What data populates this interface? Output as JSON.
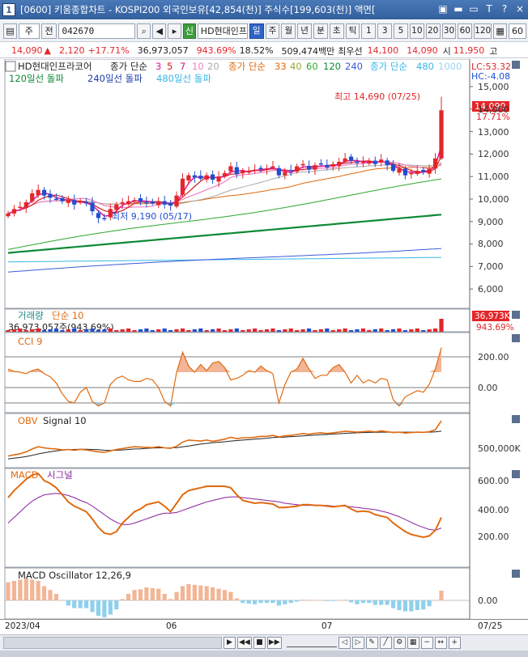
{
  "window": {
    "title": "[0600] 키움종합차트 - KOSPI200 외국인보유[42,854(천)] 주식수[199,603(천)] 액면[",
    "app_icon": "1",
    "buttons": [
      "▣",
      "▬",
      "▭",
      "T",
      "?",
      "×"
    ]
  },
  "toolbar": {
    "period_type": "주",
    "view_label": "전",
    "stock_code": "042670",
    "stock_name": "HD현대인프",
    "credit_badge": "신",
    "timeframes": [
      "일",
      "주",
      "월",
      "년",
      "분",
      "초",
      "틱"
    ],
    "timeframe_selected": "일",
    "minute_presets": [
      "1",
      "3",
      "5",
      "10",
      "20",
      "30",
      "60",
      "120"
    ],
    "count": "60"
  },
  "quote": {
    "price": "14,090",
    "change": "2,120",
    "change_pct": "+17.71%",
    "volume": "36,973,057",
    "volume_ratio": "943.69%",
    "turnover": "18.52%",
    "amount": "509,474백만",
    "best_ask_label": "최우선",
    "best_ask": "14,100",
    "best_bid": "14,090",
    "open_label": "시",
    "open": "11,950",
    "high_label": "고"
  },
  "price_panel": {
    "title": "HD현대인프라코어",
    "ma_label": "종가 단순",
    "ma_periods_1": [
      "3",
      "5",
      "7",
      "10",
      "20"
    ],
    "ma_label_2": "종가 단순",
    "ma_periods_2": [
      "33",
      "40",
      "60",
      "120",
      "240"
    ],
    "ma_label_3": "종가 단순",
    "ma_periods_3": [
      "480",
      "1000"
    ],
    "breakout_labels": [
      "120일선 돌파",
      "240일선 돌파",
      "480일선 돌파"
    ],
    "lc": "LC:53.32",
    "hc": "HC:-4.08",
    "high_note": "최고 14,690 (07/25)",
    "low_note": "최저 9,190 (05/17)",
    "price_tag": "14,090",
    "pct_tag": "17.71%",
    "y_ticks": [
      "15,000",
      "14,000",
      "13,000",
      "12,000",
      "11,000",
      "10,000",
      "9,000",
      "8,000",
      "7,000",
      "6,000"
    ]
  },
  "volume_panel": {
    "title": "거래량",
    "ma_label": "단순 10",
    "value_text": "36,973,057주(943.69%)",
    "tag_value": "36,973K",
    "tag_pct": "943.69%"
  },
  "cci_panel": {
    "title": "CCI 9",
    "y_ticks": [
      "200.00",
      "0.00"
    ]
  },
  "obv_panel": {
    "title": "OBV",
    "signal": "Signal 10",
    "y_ticks": [
      "500,000K"
    ]
  },
  "macd_panel": {
    "title": "MACD",
    "signal": "시그널",
    "y_ticks": [
      "600.00",
      "400.00",
      "200.00"
    ]
  },
  "osc_panel": {
    "title": "MACD Oscillator 12,26,9",
    "y_ticks": [
      "0.00"
    ]
  },
  "dates": {
    "d1": "2023/04",
    "d2": "06",
    "d3": "07",
    "cursor": "07/25"
  },
  "colors": {
    "up": "#e3262a",
    "down": "#1f4fd0",
    "ma_short": "#e0189a",
    "ma_33": "#e06a10",
    "ma_60": "#2fa72f",
    "ma_120": "#0d8a37",
    "ma_240": "#3b5bd8",
    "ma_480": "#36b6e8",
    "osc_up": "#f2b596",
    "osc_down": "#8fd0ec"
  },
  "chart_data": {
    "type": "candlestick",
    "x_start": "2023/04",
    "x_end": "07/25",
    "price_close": [
      9500,
      9700,
      9800,
      10000,
      10400,
      10550,
      10300,
      10200,
      10150,
      10050,
      10100,
      9900,
      10050,
      9950,
      9600,
      9300,
      9250,
      9700,
      9900,
      10000,
      10050,
      10100,
      10050,
      10000,
      9950,
      10050,
      9900,
      9850,
      10300,
      11050,
      11200,
      11100,
      11050,
      11200,
      11000,
      11150,
      11300,
      11600,
      11250,
      11400,
      11400,
      11450,
      11500,
      11500,
      11600,
      11200,
      11350,
      11400,
      11600,
      11700,
      11450,
      11650,
      11700,
      11550,
      11700,
      11800,
      11950,
      11850,
      11750,
      11800,
      11850,
      11700,
      11900,
      11650,
      11400,
      11500,
      11200,
      11300,
      11400,
      11350,
      11500,
      11950,
      14090
    ],
    "cci": [
      120,
      105,
      100,
      90,
      110,
      120,
      90,
      70,
      30,
      -40,
      -90,
      -100,
      -30,
      0,
      -90,
      -120,
      -100,
      20,
      60,
      75,
      50,
      40,
      40,
      60,
      50,
      0,
      -90,
      -120,
      100,
      230,
      140,
      100,
      150,
      110,
      160,
      170,
      130,
      50,
      60,
      80,
      110,
      100,
      140,
      110,
      90,
      -100,
      20,
      100,
      120,
      190,
      120,
      60,
      80,
      80,
      130,
      150,
      100,
      30,
      80,
      30,
      50,
      30,
      60,
      50,
      -80,
      -120,
      -60,
      -40,
      -20,
      -30,
      20,
      120,
      260
    ],
    "obv": [
      0,
      5,
      10,
      18,
      30,
      40,
      35,
      32,
      30,
      26,
      28,
      25,
      28,
      26,
      22,
      18,
      16,
      22,
      28,
      32,
      36,
      40,
      38,
      37,
      36,
      40,
      35,
      33,
      42,
      60,
      68,
      66,
      64,
      68,
      63,
      67,
      72,
      80,
      74,
      78,
      78,
      80,
      84,
      84,
      88,
      82,
      86,
      88,
      92,
      96,
      93,
      97,
      99,
      96,
      99,
      102,
      106,
      104,
      102,
      104,
      106,
      103,
      107,
      104,
      100,
      102,
      98,
      100,
      102,
      101,
      104,
      112,
      150
    ],
    "obv_signal": [
      -12,
      -9,
      -6,
      -2,
      3,
      9,
      14,
      18,
      22,
      25,
      27,
      28,
      29,
      29,
      28,
      27,
      25,
      24,
      25,
      26,
      28,
      30,
      31,
      33,
      34,
      35,
      35,
      35,
      36,
      39,
      43,
      47,
      51,
      54,
      57,
      59,
      61,
      64,
      66,
      68,
      70,
      72,
      74,
      76,
      79,
      80,
      81,
      83,
      84,
      86,
      88,
      89,
      91,
      92,
      94,
      95,
      97,
      98,
      99,
      100,
      101,
      101,
      102,
      102,
      102,
      102,
      102,
      102,
      102,
      102,
      102,
      103,
      106
    ],
    "macd": [
      480,
      530,
      570,
      610,
      640,
      650,
      600,
      580,
      550,
      500,
      450,
      420,
      400,
      380,
      330,
      270,
      230,
      220,
      240,
      300,
      340,
      380,
      400,
      430,
      440,
      450,
      420,
      380,
      440,
      500,
      530,
      540,
      550,
      560,
      560,
      560,
      560,
      550,
      500,
      460,
      450,
      440,
      445,
      440,
      435,
      410,
      410,
      415,
      420,
      430,
      430,
      425,
      425,
      420,
      415,
      420,
      425,
      400,
      380,
      385,
      380,
      360,
      350,
      340,
      300,
      270,
      240,
      220,
      210,
      200,
      210,
      250,
      340
    ],
    "macd_signal": [
      300,
      340,
      380,
      420,
      455,
      480,
      500,
      505,
      510,
      505,
      495,
      480,
      460,
      445,
      420,
      390,
      360,
      330,
      305,
      290,
      290,
      300,
      315,
      330,
      345,
      360,
      370,
      370,
      375,
      390,
      405,
      420,
      435,
      450,
      460,
      470,
      480,
      485,
      485,
      480,
      475,
      470,
      465,
      460,
      455,
      450,
      440,
      435,
      430,
      425,
      425,
      425,
      425,
      425,
      420,
      420,
      420,
      415,
      410,
      405,
      400,
      395,
      385,
      375,
      360,
      345,
      325,
      305,
      285,
      270,
      255,
      250,
      265
    ],
    "osc": [
      140,
      150,
      160,
      170,
      160,
      150,
      110,
      80,
      50,
      0,
      -40,
      -60,
      -60,
      -60,
      -90,
      -120,
      -130,
      -110,
      -70,
      10,
      50,
      80,
      85,
      100,
      95,
      90,
      50,
      10,
      65,
      110,
      125,
      120,
      115,
      110,
      100,
      90,
      80,
      65,
      15,
      -20,
      -25,
      -30,
      -20,
      -20,
      -20,
      -40,
      -30,
      -20,
      -10,
      5,
      5,
      0,
      0,
      -5,
      -5,
      0,
      5,
      -15,
      -30,
      -20,
      -20,
      -35,
      -35,
      -35,
      -60,
      -75,
      -85,
      -85,
      -75,
      -70,
      -45,
      0,
      75
    ]
  }
}
